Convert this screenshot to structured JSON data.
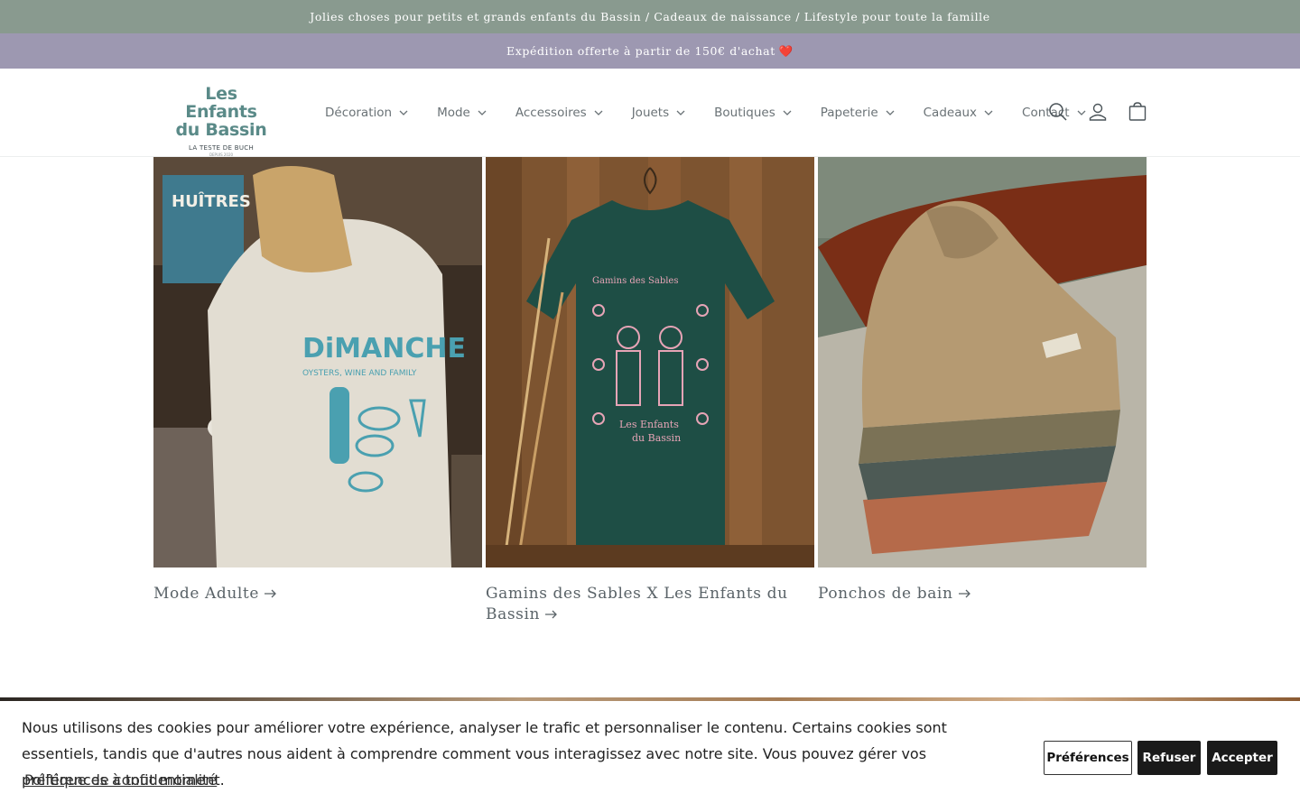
{
  "announcement": {
    "text": "Jolies choses pour petits et grands enfants du Bassin / Cadeaux de naissance / Lifestyle pour toute la famille"
  },
  "promo": {
    "text": "Expédition offerte à partir de 150€ d'achat",
    "emoji": "❤️"
  },
  "logo": {
    "line1": "Les Enfants",
    "line2": "du Bassin",
    "tagline": "LA TESTE DE BUCH",
    "small": "DEPUIS 2020"
  },
  "nav": {
    "items": [
      {
        "label": "Décoration"
      },
      {
        "label": "Mode"
      },
      {
        "label": "Accessoires"
      },
      {
        "label": "Jouets"
      },
      {
        "label": "Boutiques"
      },
      {
        "label": "Papeterie"
      },
      {
        "label": "Cadeaux"
      },
      {
        "label": "Contact"
      }
    ]
  },
  "header_icons": {
    "search": "search-icon",
    "account": "account-icon",
    "cart": "cart-icon"
  },
  "collections": [
    {
      "title": "Mode Adulte",
      "image": "t-shirt-dimanche-photo"
    },
    {
      "title": "Gamins des Sables X Les Enfants du Bassin",
      "image": "green-t-shirt-photo"
    },
    {
      "title": "Ponchos de bain",
      "image": "folded-ponchos-photo"
    }
  ],
  "cookie_banner": {
    "message": "Nous utilisons des cookies pour améliorer votre expérience, analyser le trafic et personnaliser le contenu. Certains cookies sont essentiels, tandis que d'autres nous aident à comprendre comment vous interagissez avec notre site. Vous pouvez gérer vos préférences à tout moment.",
    "policy_link": "Politique de confidentialité",
    "preferences": "Préférences",
    "refuse": "Refuser",
    "accept": "Accepter"
  },
  "colors": {
    "announcement_bg": "#899a8f",
    "promo_bg": "#9d98b1",
    "logo_teal": "#5a8a88",
    "button_dark": "#1a1a1a"
  }
}
